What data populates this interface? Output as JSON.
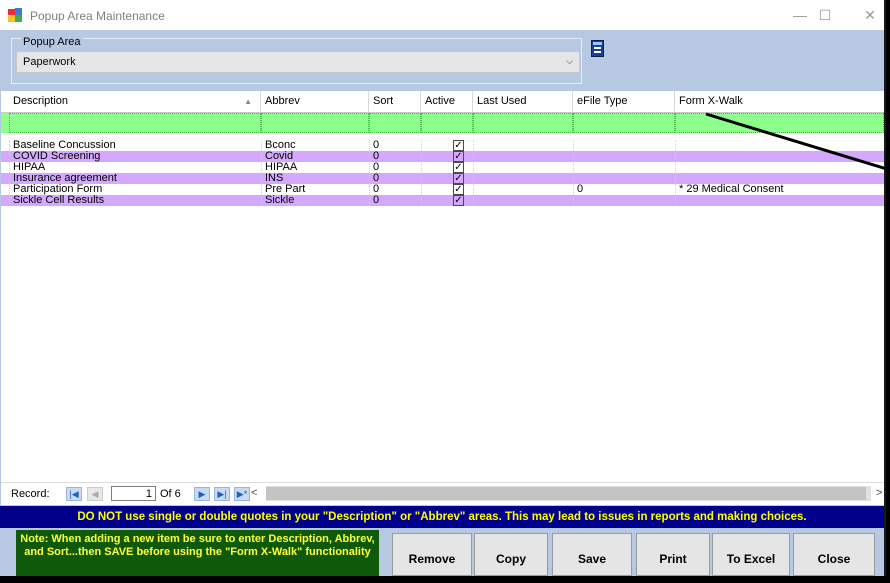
{
  "window": {
    "title": "Popup Area Maintenance",
    "min_glyph": "—",
    "max_glyph": "☐",
    "close_glyph": "✕"
  },
  "popup_area": {
    "label": "Popup Area",
    "value": "Paperwork",
    "arrow": "⌵"
  },
  "grid": {
    "columns": [
      "Description",
      "Abbrev",
      "Sort",
      "Active",
      "Last Used",
      "eFile Type",
      "Form X-Walk"
    ],
    "sort_indicator": "▲",
    "rows": [
      {
        "description": "Baseline Concussion",
        "abbrev": "Bconc",
        "sort": "0",
        "active": true,
        "last_used": "",
        "efile_type": "",
        "form_xwalk": "",
        "shade": "white"
      },
      {
        "description": "COVID Screening",
        "abbrev": "Covid",
        "sort": "0",
        "active": true,
        "last_used": "",
        "efile_type": "",
        "form_xwalk": "",
        "shade": "purple"
      },
      {
        "description": "HIPAA",
        "abbrev": "HIPAA",
        "sort": "0",
        "active": true,
        "last_used": "",
        "efile_type": "",
        "form_xwalk": "",
        "shade": "white"
      },
      {
        "description": "Insurance agreement",
        "abbrev": "INS",
        "sort": "0",
        "active": true,
        "last_used": "",
        "efile_type": "",
        "form_xwalk": "",
        "shade": "purple"
      },
      {
        "description": "Participation Form",
        "abbrev": "Pre Part",
        "sort": "0",
        "active": true,
        "last_used": "",
        "efile_type": "0",
        "form_xwalk": "* 29 Medical Consent",
        "shade": "white"
      },
      {
        "description": "Sickle Cell Results",
        "abbrev": "Sickle",
        "sort": "0",
        "active": true,
        "last_used": "",
        "efile_type": "",
        "form_xwalk": "",
        "shade": "purple"
      }
    ]
  },
  "record_nav": {
    "label": "Record:",
    "current": "1",
    "of_text": "Of  6",
    "first": "|◀",
    "prev": "◀",
    "next": "▶",
    "last": "▶|",
    "new": "▶*",
    "scroll_left": "<",
    "scroll_right": ">"
  },
  "warning": "DO NOT use single or double quotes in your \"Description\" or \"Abbrev\" areas.  This may lead to issues in reports and making choices.",
  "note": "Note:  When adding a new item be sure to enter Description, Abbrev, and Sort...then SAVE before using the \"Form X-Walk\" functionality",
  "buttons": {
    "remove": "Remove",
    "copy": "Copy",
    "save": "Save",
    "print": "Print",
    "excel": "To Excel",
    "close": "Close"
  },
  "colors": {
    "background": "#b7c8e2",
    "new_row": "#8dff8d",
    "alt_row": "#d5a8ff",
    "warning_bg": "#00008b",
    "warning_text": "#ffff00",
    "note_bg": "#0e5a0a"
  },
  "icons": {
    "app": "multicolor-app-icon",
    "book": "book-icon"
  }
}
